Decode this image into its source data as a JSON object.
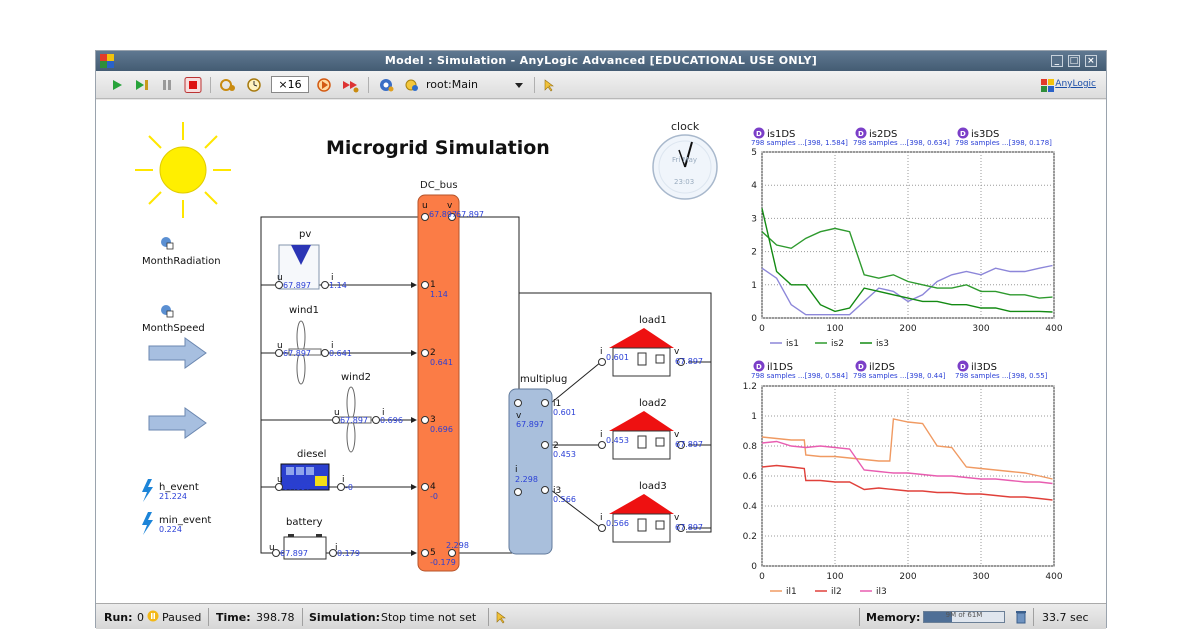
{
  "window": {
    "title": "Model : Simulation - AnyLogic Advanced [EDUCATIONAL USE ONLY]",
    "min_glyph": "_",
    "max_glyph": "□",
    "close_glyph": "×"
  },
  "toolbar": {
    "speed": "×16",
    "experiment": "root:Main",
    "logo": "AnyLogic"
  },
  "model": {
    "title": "Microgrid Simulation",
    "clock": {
      "label": "clock",
      "date": "Fri May",
      "time": "23:03"
    },
    "dc_bus": "DC_bus",
    "left_params": {
      "month_radiation": "MonthRadiation",
      "month_speed": "MonthSpeed",
      "h_event": "h_event",
      "h_event_val": "21.224",
      "min_event": "min_event",
      "min_event_val": "0.224"
    },
    "components": {
      "pv": "pv",
      "wind1": "wind1",
      "wind2": "wind2",
      "diesel": "diesel",
      "battery": "battery",
      "multiplug": "multiplug",
      "load1": "load1",
      "load2": "load2",
      "load3": "load3"
    },
    "ports": {
      "u": "u",
      "v": "v",
      "i": "i",
      "i1": "i1",
      "i2": "i2",
      "i3": "i3",
      "p1": "1",
      "p2": "2",
      "p3": "3",
      "p4": "4",
      "p5": "5"
    },
    "values": {
      "bus_u": "67.897",
      "bus_v": "67.897",
      "pv_u": "67.897",
      "pv_i": "1.14",
      "bus_i1": "1.14",
      "wind1_u": "67.897",
      "wind1_i": "0.641",
      "bus_i2": "0.641",
      "wind2_u": "67.897",
      "wind2_i": "0.696",
      "bus_i3": "0.696",
      "diesel_u": "67.897",
      "diesel_i": "-0",
      "bus_i4": "-0",
      "battery_u": "67.897",
      "battery_i": "0.179",
      "bus_i5": "-0.179",
      "bus_v5": "2.298",
      "mp_v": "67.897",
      "mp_i": "2.298",
      "mp_i1": "0.601",
      "mp_i2": "0.453",
      "mp_i3": "0.566",
      "load1_i": "0.601",
      "load1_v": "67.897",
      "load2_i": "0.453",
      "load2_v": "67.897",
      "load3_i": "0.566",
      "load3_v": "67.897"
    }
  },
  "chart_data": [
    {
      "type": "line",
      "title": "",
      "datasets_header": [
        {
          "name": "is1DS",
          "info": "798 samples ...[398, 1.584]"
        },
        {
          "name": "is2DS",
          "info": "798 samples ...[398, 0.634]"
        },
        {
          "name": "is3DS",
          "info": "798 samples ...[398, 0.178]"
        }
      ],
      "xlim": [
        0,
        400
      ],
      "ylim": [
        0,
        5
      ],
      "xticks": [
        "0",
        "100",
        "200",
        "300",
        "400"
      ],
      "yticks": [
        "0",
        "1",
        "2",
        "3",
        "4",
        "5"
      ],
      "grid": true,
      "legend": "bottom",
      "series": [
        {
          "name": "is1",
          "color": "#8c86d9",
          "x": [
            0,
            20,
            40,
            60,
            80,
            100,
            120,
            140,
            160,
            180,
            200,
            220,
            240,
            260,
            280,
            300,
            320,
            340,
            360,
            380,
            398
          ],
          "values": [
            1.5,
            1.2,
            0.4,
            0.1,
            0.1,
            0.1,
            0.1,
            0.5,
            0.9,
            0.8,
            0.5,
            0.7,
            1.1,
            1.3,
            1.4,
            1.3,
            1.5,
            1.4,
            1.4,
            1.5,
            1.58
          ]
        },
        {
          "name": "is2",
          "color": "#2e9a2e",
          "x": [
            0,
            20,
            40,
            60,
            80,
            100,
            120,
            140,
            160,
            180,
            200,
            220,
            240,
            260,
            280,
            300,
            320,
            340,
            360,
            380,
            398
          ],
          "values": [
            2.6,
            2.2,
            2.1,
            2.4,
            2.6,
            2.7,
            2.6,
            1.3,
            1.2,
            1.3,
            1.1,
            1.0,
            0.9,
            0.9,
            1.0,
            0.8,
            0.8,
            0.7,
            0.7,
            0.6,
            0.63
          ]
        },
        {
          "name": "is3",
          "color": "#138a13",
          "x": [
            0,
            20,
            40,
            60,
            80,
            100,
            120,
            140,
            160,
            180,
            200,
            220,
            240,
            260,
            280,
            300,
            320,
            340,
            360,
            380,
            398
          ],
          "values": [
            3.3,
            1.4,
            1.0,
            1.0,
            0.4,
            0.2,
            0.3,
            0.9,
            0.8,
            0.7,
            0.6,
            0.5,
            0.5,
            0.4,
            0.4,
            0.3,
            0.3,
            0.2,
            0.2,
            0.2,
            0.18
          ]
        }
      ]
    },
    {
      "type": "line",
      "title": "",
      "datasets_header": [
        {
          "name": "il1DS",
          "info": "798 samples ...[398, 0.584]"
        },
        {
          "name": "il2DS",
          "info": "798 samples ...[398, 0.44]"
        },
        {
          "name": "il3DS",
          "info": "798 samples ...[398, 0.55]"
        }
      ],
      "xlim": [
        0,
        400
      ],
      "ylim": [
        0,
        1.2
      ],
      "xticks": [
        "0",
        "100",
        "200",
        "300",
        "400"
      ],
      "yticks": [
        "0",
        "0.2",
        "0.4",
        "0.6",
        "0.8",
        "1",
        "1.2"
      ],
      "grid": true,
      "legend": "bottom",
      "series": [
        {
          "name": "il1",
          "color": "#f09a62",
          "x": [
            0,
            20,
            40,
            58,
            60,
            80,
            100,
            120,
            140,
            160,
            175,
            180,
            200,
            220,
            240,
            260,
            280,
            300,
            320,
            340,
            360,
            380,
            398
          ],
          "values": [
            0.86,
            0.85,
            0.84,
            0.84,
            0.74,
            0.73,
            0.73,
            0.72,
            0.71,
            0.7,
            0.7,
            0.98,
            0.96,
            0.95,
            0.8,
            0.79,
            0.66,
            0.65,
            0.64,
            0.63,
            0.62,
            0.6,
            0.58
          ]
        },
        {
          "name": "il2",
          "color": "#e0403a",
          "x": [
            0,
            20,
            40,
            58,
            60,
            80,
            100,
            120,
            140,
            160,
            180,
            200,
            220,
            240,
            260,
            280,
            300,
            320,
            340,
            360,
            380,
            398
          ],
          "values": [
            0.66,
            0.67,
            0.66,
            0.65,
            0.57,
            0.57,
            0.56,
            0.56,
            0.51,
            0.52,
            0.51,
            0.5,
            0.5,
            0.49,
            0.49,
            0.48,
            0.48,
            0.47,
            0.46,
            0.46,
            0.45,
            0.44
          ]
        },
        {
          "name": "il3",
          "color": "#e85db0",
          "x": [
            0,
            20,
            40,
            60,
            80,
            100,
            120,
            140,
            160,
            180,
            200,
            220,
            240,
            260,
            280,
            300,
            320,
            340,
            360,
            380,
            398
          ],
          "values": [
            0.82,
            0.83,
            0.8,
            0.79,
            0.8,
            0.79,
            0.78,
            0.64,
            0.63,
            0.62,
            0.62,
            0.61,
            0.6,
            0.6,
            0.59,
            0.58,
            0.58,
            0.57,
            0.56,
            0.56,
            0.55
          ]
        }
      ]
    }
  ],
  "status": {
    "run_label": "Run:",
    "run_value": "0",
    "paused": "Paused",
    "time_label": "Time:",
    "time_value": "398.78",
    "sim_label": "Simulation:",
    "sim_value": "Stop time not set",
    "memory_label": "Memory:",
    "memory_value": "9M of 61M",
    "elapsed": "33.7 sec"
  }
}
